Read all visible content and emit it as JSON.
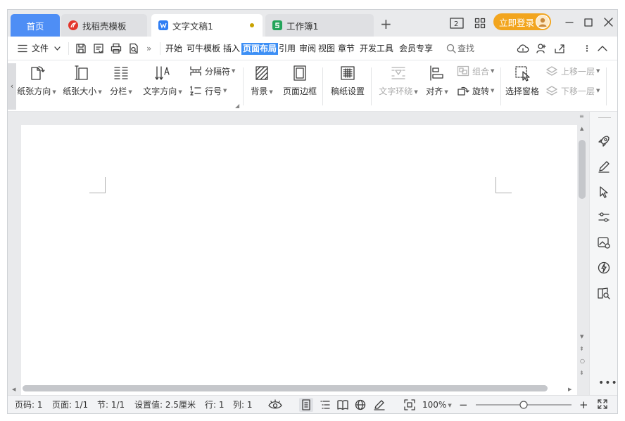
{
  "tabs": {
    "home": "首页",
    "template": "找稻壳模板",
    "doc": "文字文稿1",
    "sheet": "工作簿1"
  },
  "window": {
    "login": "立即登录"
  },
  "menu": {
    "file": "文件",
    "items": [
      "开始",
      "可牛模板",
      "插入",
      "页面布局",
      "引用",
      "审阅",
      "视图",
      "章节",
      "开发工具",
      "会员专享"
    ],
    "search": "查找"
  },
  "ribbon": {
    "orientation": "纸张方向",
    "size": "纸张大小",
    "columns": "分栏",
    "text_direction": "文字方向",
    "breaks": "分隔符",
    "line_numbers": "行号",
    "background": "背景",
    "page_border": "页面边框",
    "grid_paper": "稿纸设置",
    "wrap": "文字环绕",
    "align": "对齐",
    "group": "组合",
    "rotate": "旋转",
    "selection_pane": "选择窗格",
    "bring_forward": "上移一层",
    "send_backward": "下移一层"
  },
  "status": {
    "page_num": "页码: 1",
    "pages": "页面: 1/1",
    "section": "节: 1/1",
    "setting": "设置值: 2.5厘米",
    "row": "行: 1",
    "col": "列: 1",
    "zoom": "100%"
  },
  "colors": {
    "accent": "#3d8ff5",
    "home_tab": "#4e8ef5",
    "login": "#f2a51e"
  }
}
